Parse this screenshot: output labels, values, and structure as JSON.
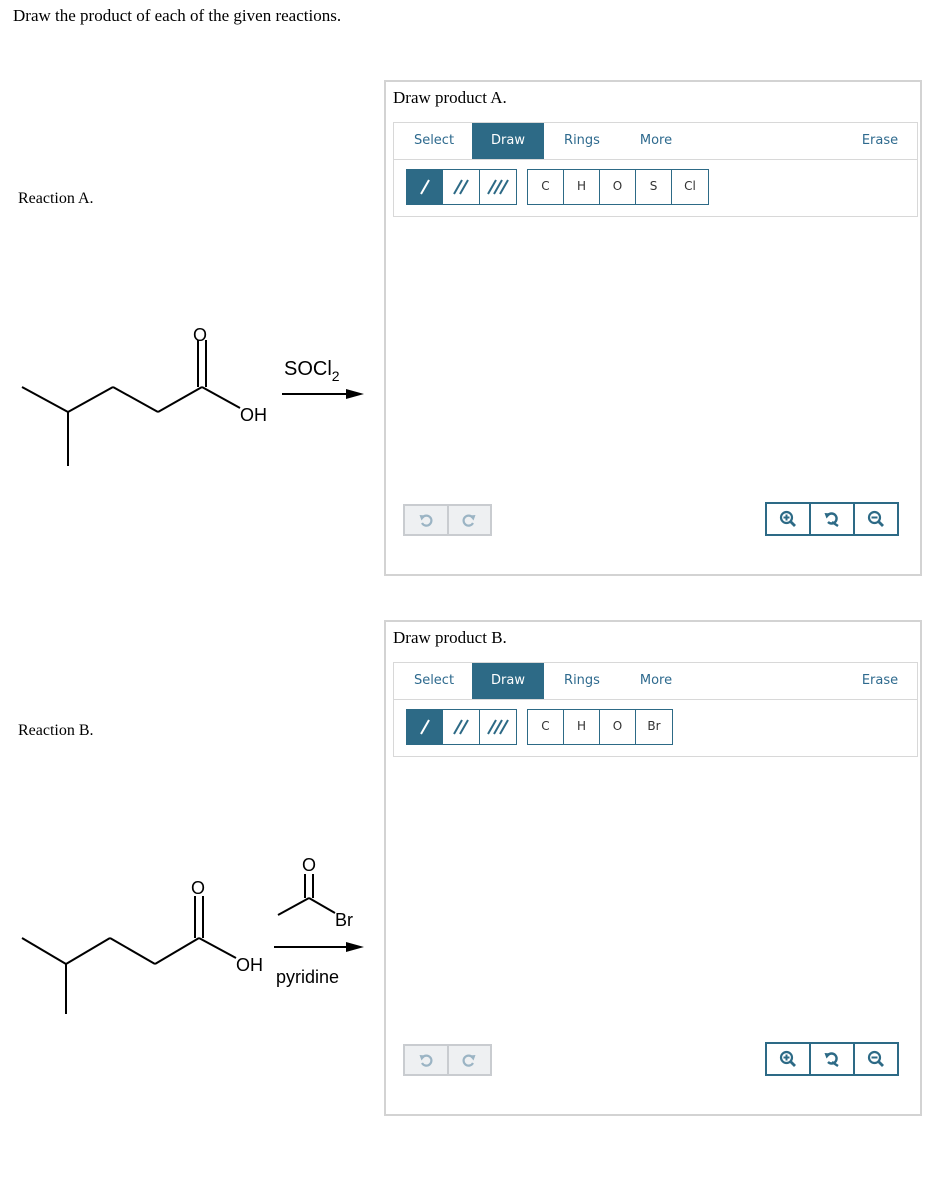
{
  "instruction": "Draw the product of each of the given reactions.",
  "reactions": [
    {
      "label": "Reaction A.",
      "reagent_main": "SOCl",
      "reagent_sub": "2",
      "oh_label": "OH",
      "o_label": "O",
      "panel": {
        "title": "Draw product A.",
        "tabs": [
          "Select",
          "Draw",
          "Rings",
          "More",
          "Erase"
        ],
        "active_tab": "Draw",
        "atoms": [
          "C",
          "H",
          "O",
          "S",
          "Cl"
        ]
      }
    },
    {
      "label": "Reaction B.",
      "reagent_o": "O",
      "reagent_br": "Br",
      "condition": "pyridine",
      "oh_label": "OH",
      "o_label": "O",
      "panel": {
        "title": "Draw product B.",
        "tabs": [
          "Select",
          "Draw",
          "Rings",
          "More",
          "Erase"
        ],
        "active_tab": "Draw",
        "atoms": [
          "C",
          "H",
          "O",
          "Br"
        ]
      }
    }
  ],
  "icons": {
    "bond_tools": [
      "single-bond-icon",
      "double-bond-icon",
      "triple-bond-icon"
    ],
    "history": [
      "undo-icon",
      "redo-icon"
    ],
    "zoom": [
      "zoom-in-icon",
      "zoom-reset-icon",
      "zoom-out-icon"
    ]
  },
  "colors": {
    "accent": "#2d6a86",
    "tab_text": "#2e6a8e",
    "border": "#d3d3d3"
  }
}
